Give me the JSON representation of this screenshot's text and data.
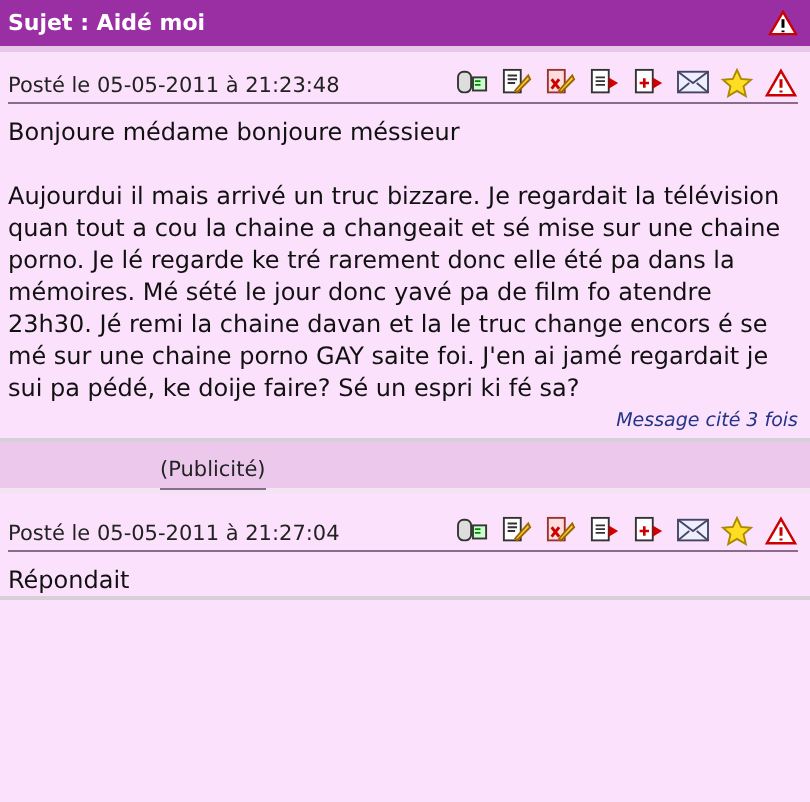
{
  "topic": {
    "title": "Sujet : Aidé moi"
  },
  "posts": [
    {
      "date": "Posté le 05-05-2011 à 21:23:48",
      "paragraphs": [
        "Bonjoure médame bonjoure méssieur",
        "Aujourdui il mais arrivé un truc bizzare. Je regardait la télévision quan tout a cou la chaine a changeait et sé mise sur une chaine porno. Je lé regarde ke tré rarement donc elle été pa dans la mémoires. Mé sété le jour donc yavé pa de film fo atendre 23h30. Jé remi la chaine davan et la le truc change encors é se mé sur une chaine porno GAY saite foi. J'en ai jamé regardait je sui pa pédé, ke doije faire? Sé un espri ki fé sa?"
      ],
      "quoted": "Message cité 3 fois"
    },
    {
      "kind": "ad",
      "label": "(Publicité)"
    },
    {
      "date": "Posté le 05-05-2011 à 21:27:04",
      "paragraphs": [
        "Répondait"
      ]
    }
  ]
}
